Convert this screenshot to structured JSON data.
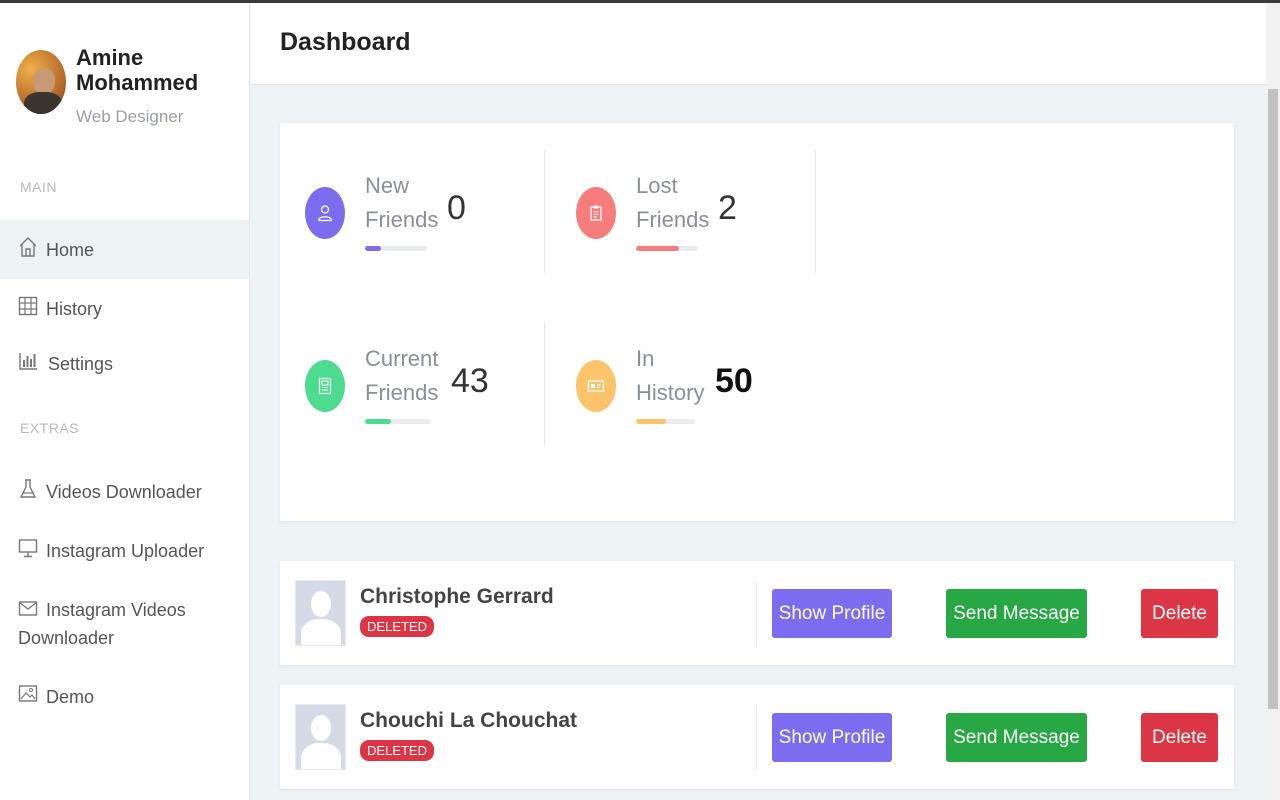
{
  "profile": {
    "name": "Amine Mohammed",
    "role": "Web Designer"
  },
  "sidebar": {
    "sections": [
      {
        "label": "MAIN"
      },
      {
        "label": "EXTRAS"
      }
    ],
    "main_items": [
      {
        "label": "Home",
        "icon": "home-icon",
        "active": true
      },
      {
        "label": "History",
        "icon": "grid-icon"
      },
      {
        "label": "Settings",
        "icon": "bar-chart-icon"
      }
    ],
    "extra_items": [
      {
        "label": "Videos Downloader",
        "icon": "flask-icon"
      },
      {
        "label": "Instagram Uploader",
        "icon": "monitor-icon"
      },
      {
        "label": "Instagram Videos Downloader",
        "icon": "mail-icon"
      },
      {
        "label": "Demo",
        "icon": "image-icon"
      }
    ]
  },
  "header": {
    "title": "Dashboard"
  },
  "stats": [
    {
      "label": "New Friends",
      "value": "0",
      "color": "#7b6cf0",
      "icon": "user-icon",
      "progress": 0.25
    },
    {
      "label": "Lost Friends",
      "value": "2",
      "color": "#f77c7c",
      "icon": "clipboard-icon",
      "progress": 0.7
    },
    {
      "label": "Current Friends",
      "value": "43",
      "color": "#4cdb8f",
      "icon": "document-icon",
      "progress": 0.4
    },
    {
      "label": "In History",
      "value": "50",
      "color": "#fcc46a",
      "icon": "id-card-icon",
      "progress": 0.5
    }
  ],
  "friends": [
    {
      "name": "Christophe Gerrard",
      "status": "DELETED"
    },
    {
      "name": "Chouchi La Chouchat",
      "status": "DELETED"
    }
  ],
  "actions": {
    "show_profile": "Show Profile",
    "send_message": "Send Message",
    "delete": "Delete"
  },
  "colors": {
    "show_profile": "#7b6cf0",
    "send_message": "#28a745",
    "delete": "#dc3545",
    "badge": "#dc3545"
  }
}
